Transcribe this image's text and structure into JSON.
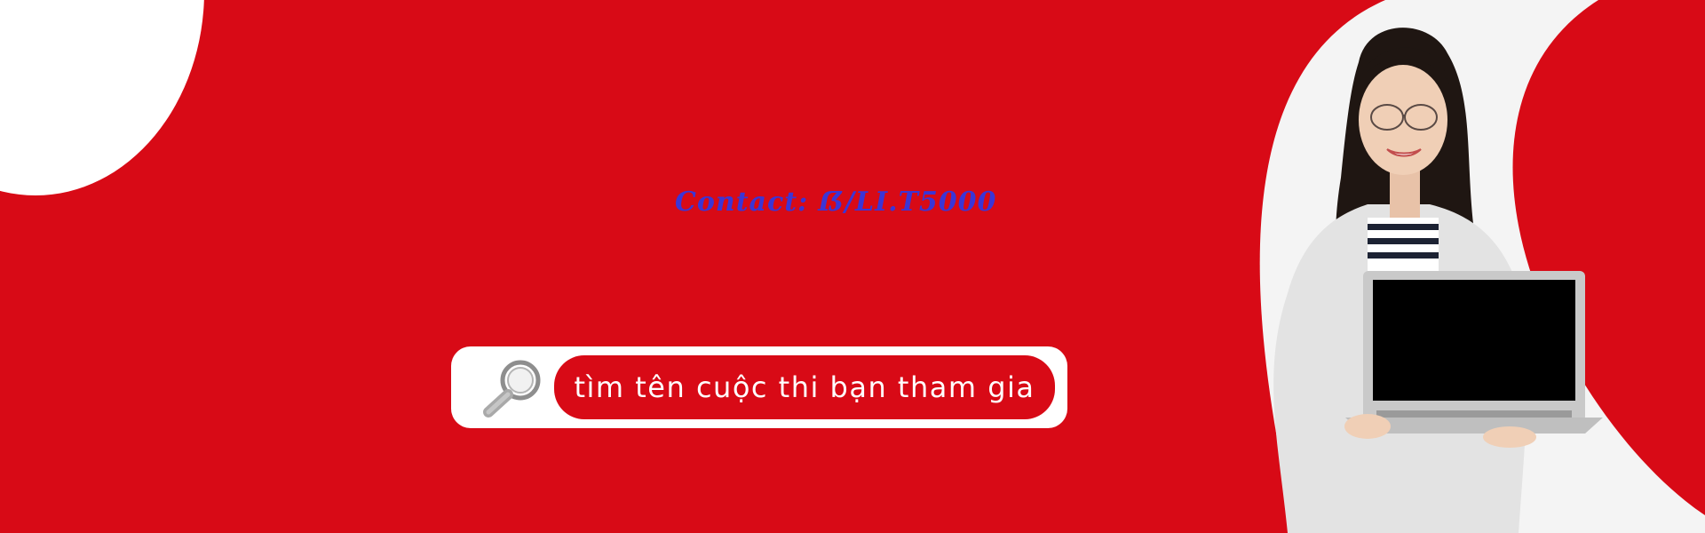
{
  "banner": {
    "contact_text": "Contact: ẞ/LI.T5000",
    "search": {
      "placeholder": "tìm tên cuộc thi bạn tham gia",
      "icon": "search-icon"
    }
  },
  "colors": {
    "background": "#d80a16",
    "accent_white": "#ffffff",
    "contact_text": "#3b35d6"
  }
}
